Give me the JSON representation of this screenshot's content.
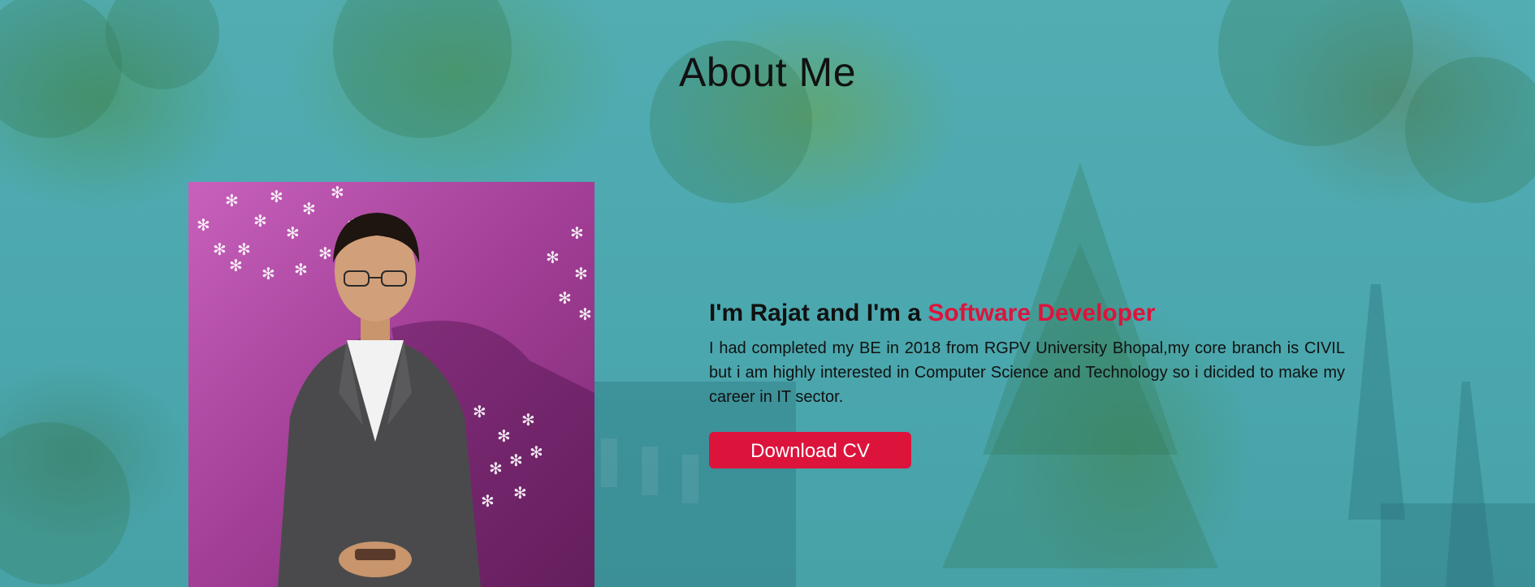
{
  "about": {
    "title": "About Me",
    "heading_prefix": "I'm Rajat and I'm a ",
    "heading_accent": "Software Developer",
    "description": "I had completed my BE in 2018 from RGPV University Bhopal,my core branch is CIVIL but i am highly interested in Computer Science and Technology so i dicided to make my career in IT sector.",
    "button_label": "Download CV"
  },
  "colors": {
    "accent": "#dc143c",
    "background_teal": "#4aa7ad",
    "photo_wall": "#a13e96"
  }
}
